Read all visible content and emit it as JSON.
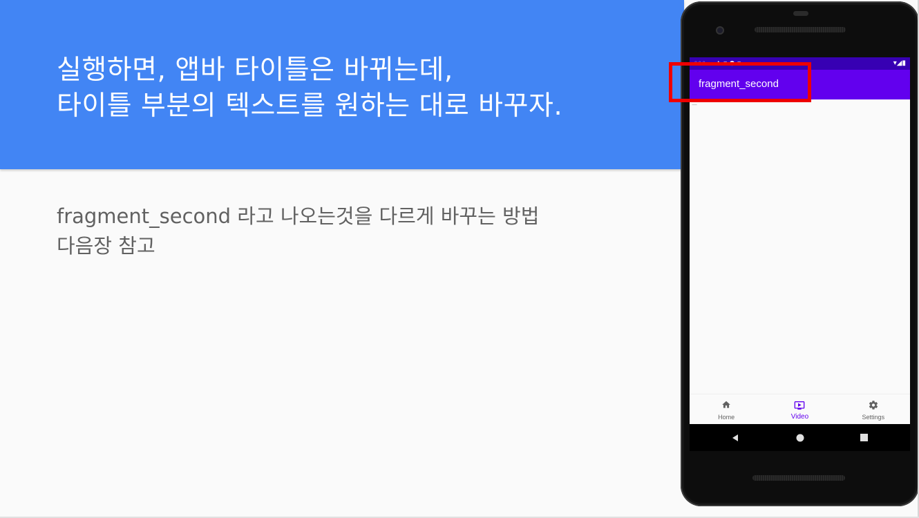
{
  "slide": {
    "title_line1": "실행하면, 앱바 타이틀은 바뀌는데,",
    "title_line2": "타이틀 부분의 텍스트를 원하는 대로 바꾸자.",
    "body_line1": "fragment_second 라고 나오는것을 다르게 바꾸는 방법",
    "body_line2": "다음장 참고"
  },
  "phone": {
    "app_bar_title": "fragment_second",
    "bottom_nav": [
      {
        "label": "Home",
        "icon": "home-icon",
        "active": false
      },
      {
        "label": "Video",
        "icon": "video-icon",
        "active": true
      },
      {
        "label": "Settings",
        "icon": "gear-icon",
        "active": false
      }
    ],
    "system_nav": [
      "back-icon",
      "home-circle-icon",
      "recents-icon"
    ]
  },
  "colors": {
    "header_blue": "#4285f4",
    "app_bar_purple": "#6200ee",
    "status_bar_purple": "#3700b3",
    "highlight_red": "#ee0000"
  }
}
